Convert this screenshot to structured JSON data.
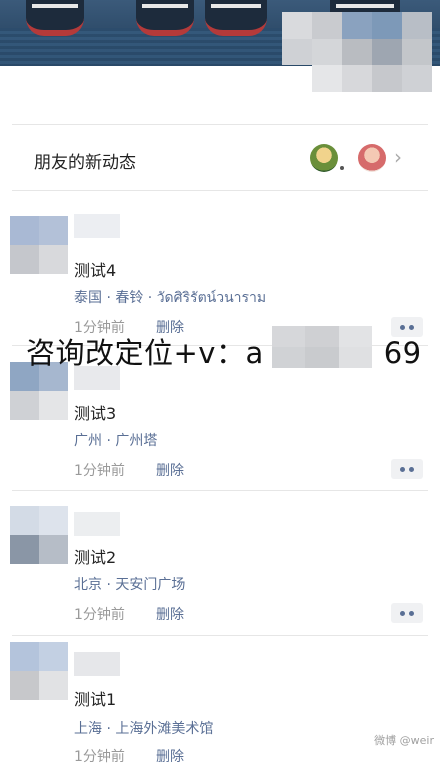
{
  "friends": {
    "title": "朋友的新动态",
    "chevron": "›"
  },
  "overlay": {
    "text": "咨询改定位+v：a",
    "suffix": "69"
  },
  "posts": [
    {
      "title": "测试4",
      "location": "泰国 · 春铃 · วัดศิริรัตน์วนาราม",
      "time": "1分钟前",
      "delete": "删除"
    },
    {
      "title": "测试3",
      "location": "广州 · 广州塔",
      "time": "1分钟前",
      "delete": "删除"
    },
    {
      "title": "测试2",
      "location": "北京 · 天安门广场",
      "time": "1分钟前",
      "delete": "删除"
    },
    {
      "title": "测试1",
      "location": "上海 · 上海外滩美术馆",
      "time": "1分钟前",
      "delete": "删除"
    }
  ],
  "watermark": "微博 @weir",
  "colors": {
    "link": "#5a6f95",
    "muted": "#9a9a9a",
    "divider": "#e6e6e6"
  },
  "icons": {
    "more": "more-dots-icon",
    "chevron": "chevron-right-icon"
  }
}
